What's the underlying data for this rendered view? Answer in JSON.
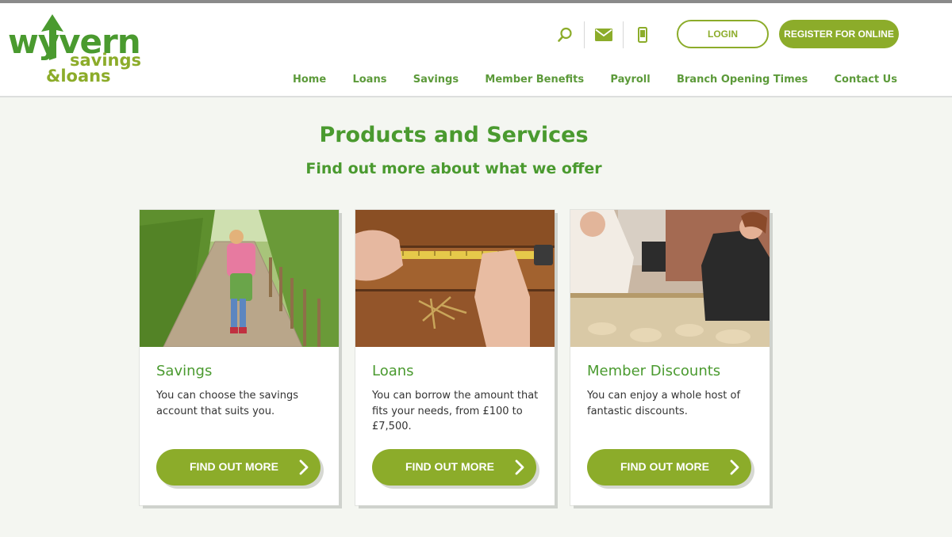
{
  "brand": {
    "line1": "wyvern",
    "line2": "savings",
    "line3": "&loans",
    "green": "#4a9a2f",
    "lime": "#8cac2a"
  },
  "header": {
    "icons": [
      "search-icon",
      "mail-icon",
      "mobile-phone-icon"
    ],
    "login_label": "LOGIN",
    "register_label": "REGISTER FOR ONLINE"
  },
  "nav": {
    "items": [
      "Home",
      "Loans",
      "Savings",
      "Member Benefits",
      "Payroll",
      "Branch Opening Times",
      "Contact Us"
    ]
  },
  "main": {
    "title": "Products and Services",
    "subtitle": "Find out more about what we offer",
    "cards": [
      {
        "title": "Savings",
        "text": "You can choose the savings account that suits you.",
        "button": "FIND OUT MORE"
      },
      {
        "title": "Loans",
        "text": "You can borrow the amount that fits your needs, from £100 to £7,500.",
        "button": "FIND OUT MORE"
      },
      {
        "title": "Member Discounts",
        "text": "You can enjoy a whole host of fantastic discounts.",
        "button": "FIND OUT MORE"
      }
    ]
  }
}
